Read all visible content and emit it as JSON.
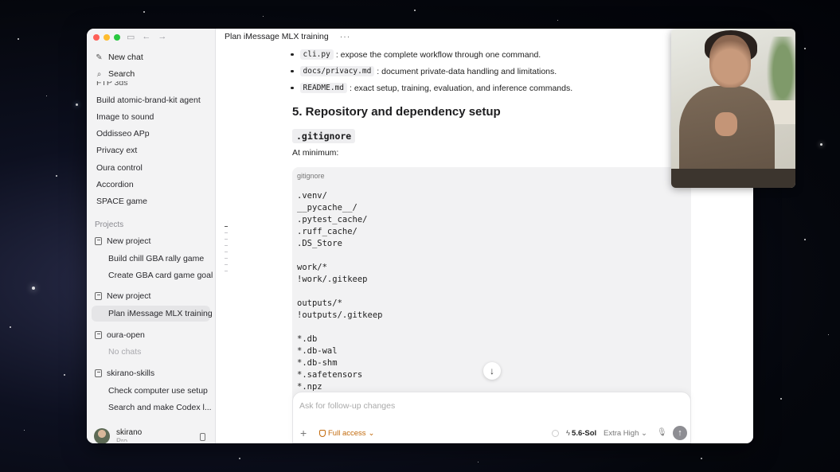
{
  "sidebar": {
    "new_chat": "New chat",
    "search": "Search",
    "chats": [
      "FTP 3ds",
      "Build atomic-brand-kit agent",
      "Image to sound",
      "Oddisseo APp",
      "Privacy ext",
      "Oura control",
      "Accordion",
      "SPACE game"
    ],
    "projects_heading": "Projects",
    "projects": [
      {
        "name": "New project",
        "chats": [
          "Build chill GBA rally game",
          "Create GBA card game goal"
        ]
      },
      {
        "name": "New project",
        "chats": [
          "Plan iMessage MLX training"
        ]
      },
      {
        "name": "oura-open",
        "chats": [
          "No chats"
        ]
      },
      {
        "name": "skirano-skills",
        "chats": [
          "Check computer use setup",
          "Search and make Codex l..."
        ]
      }
    ],
    "user": {
      "name": "skirano",
      "plan": "Pro"
    }
  },
  "header": {
    "title": "Plan iMessage MLX training",
    "more": "···"
  },
  "content": {
    "bullets": [
      {
        "code": "cli.py",
        "text": ": expose the complete workflow through one command."
      },
      {
        "code": "docs/privacy.md",
        "text": ": document private-data handling and limitations."
      },
      {
        "code": "README.md",
        "text": ": exact setup, training, evaluation, and inference commands."
      }
    ],
    "section_heading": "5. Repository and dependency setup",
    "file_label": ".gitignore",
    "intro": "At minimum:",
    "code_language": "gitignore",
    "code": ".venv/\n__pycache__/\n.pytest_cache/\n.ruff_cache/\n.DS_Store\n\nwork/*\n!work/.gitkeep\n\noutputs/*\n!outputs/.gitkeep\n\n*.db\n*.db-wal\n*.db-shm\n*.safetensors\n*.npz"
  },
  "composer": {
    "placeholder": "Ask for follow-up changes",
    "access_label": "Full access",
    "model": "5.6-Sol",
    "effort": "Extra High"
  }
}
